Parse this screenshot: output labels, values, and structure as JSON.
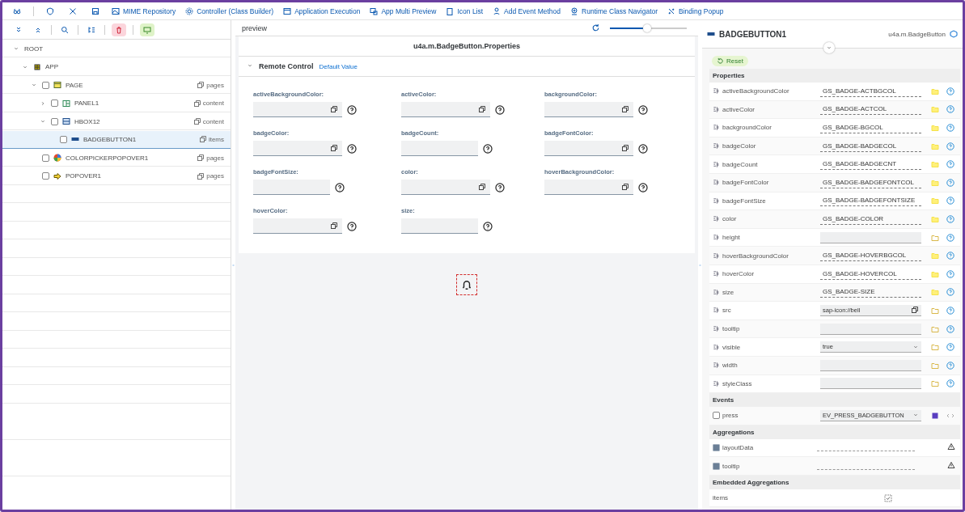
{
  "toolbar": {
    "links": [
      {
        "label": "MIME Repository",
        "kind": "image"
      },
      {
        "label": "Controller (Class Builder)",
        "kind": "gear"
      },
      {
        "label": "Application Execution",
        "kind": "window"
      },
      {
        "label": "App Multi Preview",
        "kind": "screens"
      },
      {
        "label": "Icon List",
        "kind": "clipboard"
      },
      {
        "label": "Add Event Method",
        "kind": "person"
      },
      {
        "label": "Runtime Class Navigator",
        "kind": "target"
      },
      {
        "label": "Binding Popup",
        "kind": "link"
      }
    ]
  },
  "tree": [
    {
      "label": "ROOT",
      "expanded": true,
      "selected": false,
      "children": [
        {
          "label": "APP",
          "kind": "app",
          "expanded": true,
          "selected": false,
          "children": [
            {
              "label": "PAGE",
              "kind": "page",
              "expanded": true,
              "checked": false,
              "selected": false,
              "aggregation": "pages",
              "children": [
                {
                  "label": "PANEL1",
                  "kind": "panel",
                  "expanded": false,
                  "checked": false,
                  "selected": false,
                  "aggregation": "content"
                },
                {
                  "label": "HBOX12",
                  "kind": "hbox",
                  "expanded": true,
                  "checked": false,
                  "selected": false,
                  "aggregation": "content",
                  "children": [
                    {
                      "label": "BADGEBUTTON1",
                      "kind": "badge",
                      "checked": false,
                      "selected": true,
                      "aggregation": "items"
                    }
                  ]
                }
              ]
            },
            {
              "label": "COLORPICKERPOPOVER1",
              "kind": "colorpicker",
              "checked": false,
              "selected": false,
              "aggregation": "pages"
            },
            {
              "label": "POPOVER1",
              "kind": "popover",
              "checked": false,
              "selected": false,
              "aggregation": "pages"
            }
          ]
        }
      ]
    }
  ],
  "preview": {
    "title": "preview",
    "zoom": {
      "level": 0.48
    },
    "properties_title": "u4a.m.BadgeButton.Properties",
    "section": {
      "title": "Remote Control",
      "expanded": true,
      "link": "Default Value"
    },
    "fields": [
      {
        "label": "activeBackgroundColor:",
        "kind": "color"
      },
      {
        "label": "activeColor:",
        "kind": "color"
      },
      {
        "label": "backgroundColor:",
        "kind": "color"
      },
      {
        "label": "badgeColor:",
        "kind": "color"
      },
      {
        "label": "badgeCount:",
        "kind": "text"
      },
      {
        "label": "badgeFontColor:",
        "kind": "color"
      },
      {
        "label": "badgeFontSize:",
        "kind": "text"
      },
      {
        "label": "color:",
        "kind": "color"
      },
      {
        "label": "hoverBackgroundColor:",
        "kind": "color"
      },
      {
        "label": "hoverColor:",
        "kind": "color"
      },
      {
        "label": "size:",
        "kind": "text"
      }
    ]
  },
  "inspector": {
    "name": "BADGEBUTTON1",
    "class": "u4a.m.BadgeButton",
    "reset": "Reset",
    "sections": [
      {
        "title": "Properties",
        "rows": [
          {
            "name": "activeBackgroundColor",
            "kind": "bound",
            "value": "GS_BADGE-ACTBGCOL"
          },
          {
            "name": "activeColor",
            "kind": "bound",
            "value": "GS_BADGE-ACTCOL"
          },
          {
            "name": "backgroundColor",
            "kind": "bound",
            "value": "GS_BADGE-BGCOL"
          },
          {
            "name": "badgeColor",
            "kind": "bound",
            "value": "GS_BADGE-BADGECOL"
          },
          {
            "name": "badgeCount",
            "kind": "bound",
            "value": "GS_BADGE-BADGECNT"
          },
          {
            "name": "badgeFontColor",
            "kind": "bound",
            "value": "GS_BADGE-BADGEFONTCOL"
          },
          {
            "name": "badgeFontSize",
            "kind": "bound",
            "value": "GS_BADGE-BADGEFONTSIZE"
          },
          {
            "name": "color",
            "kind": "bound",
            "value": "GS_BADGE-COLOR"
          },
          {
            "name": "height",
            "kind": "empty"
          },
          {
            "name": "hoverBackgroundColor",
            "kind": "bound",
            "value": "GS_BADGE-HOVERBGCOL"
          },
          {
            "name": "hoverColor",
            "kind": "bound",
            "value": "GS_BADGE-HOVERCOL"
          },
          {
            "name": "size",
            "kind": "bound",
            "value": "GS_BADGE-SIZE"
          },
          {
            "name": "src",
            "kind": "input",
            "value": "sap-icon://bell"
          },
          {
            "name": "tooltip",
            "kind": "empty"
          },
          {
            "name": "visible",
            "kind": "select",
            "value": "true"
          },
          {
            "name": "width",
            "kind": "empty"
          },
          {
            "name": "styleClass",
            "kind": "empty"
          }
        ]
      },
      {
        "title": "Events",
        "rows": [
          {
            "name": "press",
            "kind": "event",
            "checked": false,
            "value": "EV_PRESS_BADGEBUTTON"
          }
        ]
      },
      {
        "title": "Aggregations",
        "rows": [
          {
            "name": "layoutData",
            "kind": "aggregation"
          },
          {
            "name": "tooltip",
            "kind": "aggregation"
          }
        ]
      },
      {
        "title": "Embedded Aggregations",
        "rows": [
          {
            "name": "items",
            "kind": "embedded"
          }
        ]
      }
    ]
  }
}
